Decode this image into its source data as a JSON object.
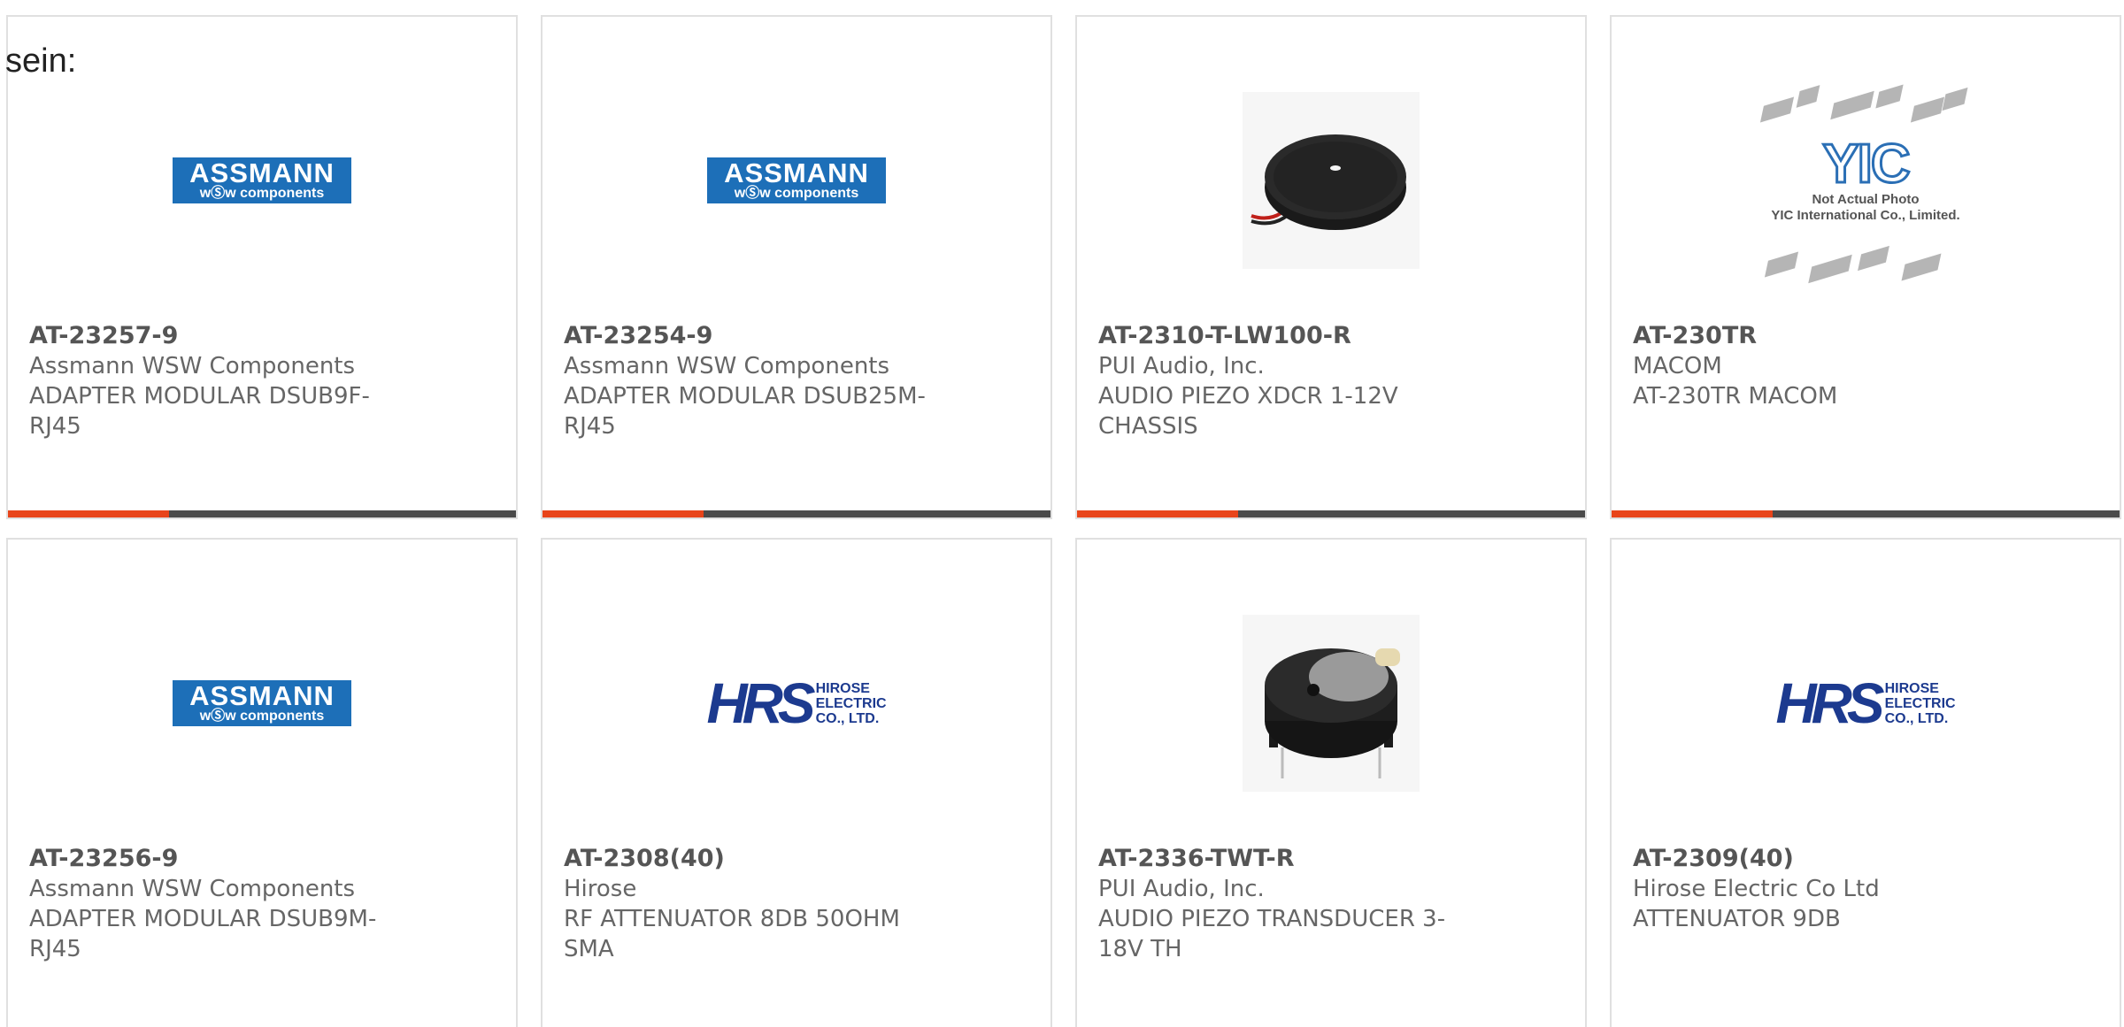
{
  "intro_text": "sein:",
  "products": [
    {
      "part": "AT-23257-9",
      "maker": "Assmann WSW Components",
      "desc": "ADAPTER MODULAR DSUB9F-RJ45",
      "image": "assmann-logo"
    },
    {
      "part": "AT-23254-9",
      "maker": "Assmann WSW Components",
      "desc": "ADAPTER MODULAR DSUB25M-RJ45",
      "image": "assmann-logo"
    },
    {
      "part": "AT-2310-T-LW100-R",
      "maker": "PUI Audio, Inc.",
      "desc": "AUDIO PIEZO XDCR 1-12V CHASSIS",
      "image": "piezo-disc-photo"
    },
    {
      "part": "AT-230TR",
      "maker": "MACOM",
      "desc": "AT-230TR MACOM",
      "image": "yic-placeholder"
    },
    {
      "part": "AT-23256-9",
      "maker": "Assmann WSW Components",
      "desc": "ADAPTER MODULAR DSUB9M-RJ45",
      "image": "assmann-logo"
    },
    {
      "part": "AT-2308(40)",
      "maker": "Hirose",
      "desc": "RF ATTENUATOR 8DB 50OHM SMA",
      "image": "hirose-logo"
    },
    {
      "part": "AT-2336-TWT-R",
      "maker": "PUI Audio, Inc.",
      "desc": "AUDIO PIEZO TRANSDUCER 3-18V TH",
      "image": "piezo-buzzer-photo"
    },
    {
      "part": "AT-2309(40)",
      "maker": "Hirose Electric Co Ltd",
      "desc": "ATTENUATOR 9DB",
      "image": "hirose-logo"
    }
  ],
  "logos": {
    "assmann_main": "ASSMANN",
    "assmann_sub": "wⓈw components",
    "hirose_mark": "HRS",
    "hirose_line1": "HIROSE",
    "hirose_line2": "ELECTRIC",
    "hirose_line3": "CO., LTD.",
    "yic_mark": "YIC",
    "yic_note1": "Not Actual Photo",
    "yic_note2": "YIC International Co., Limited."
  },
  "colors": {
    "accent": "#e8441a",
    "bar": "#4a4a4a",
    "assmann_blue": "#1d6fb8",
    "hirose_blue": "#1c3a8f"
  }
}
